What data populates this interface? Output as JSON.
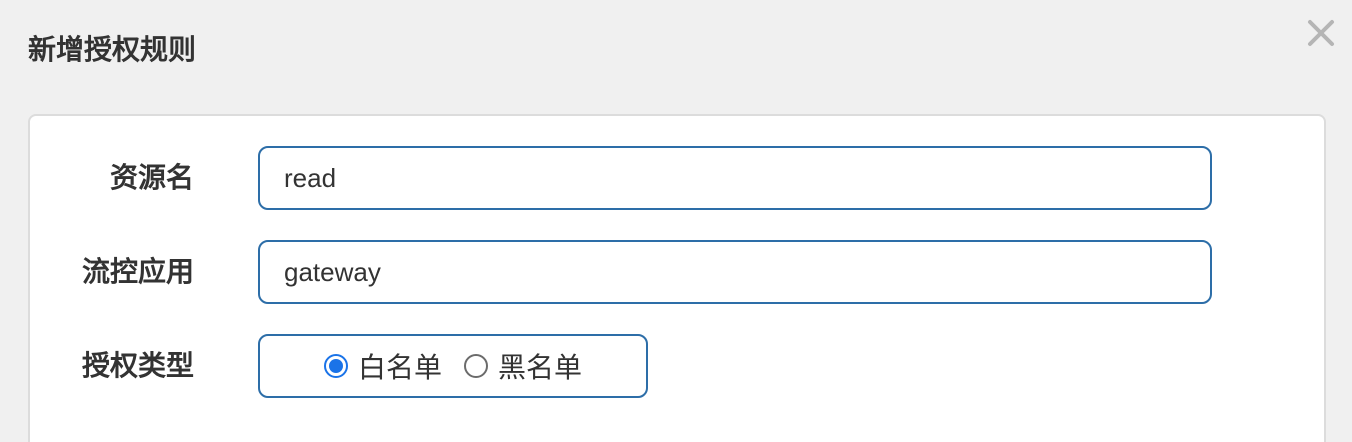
{
  "dialog": {
    "title": "新增授权规则",
    "close_icon": "close-icon"
  },
  "form": {
    "resource_name": {
      "label": "资源名",
      "value": "read"
    },
    "limit_app": {
      "label": "流控应用",
      "value": "gateway"
    },
    "auth_type": {
      "label": "授权类型",
      "options": [
        {
          "label": "白名单",
          "checked": true
        },
        {
          "label": "黑名单",
          "checked": false
        }
      ]
    }
  },
  "colors": {
    "accent": "#2d6ea8",
    "radio_checked": "#1a73e8",
    "background": "#f0f0f0",
    "panel": "#ffffff"
  }
}
